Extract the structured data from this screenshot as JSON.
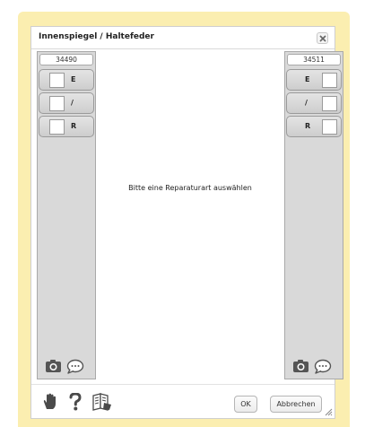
{
  "dialog": {
    "title": "Innenspiegel / Haltefeder"
  },
  "left_panel": {
    "code": "34490",
    "buttons": [
      {
        "label": "E"
      },
      {
        "label": "/"
      },
      {
        "label": "R"
      }
    ]
  },
  "right_panel": {
    "code": "34511",
    "buttons": [
      {
        "label": "E"
      },
      {
        "label": "/"
      },
      {
        "label": "R"
      }
    ]
  },
  "main": {
    "message": "Bitte eine Reparaturart auswählen"
  },
  "footer": {
    "ok_label": "OK",
    "cancel_label": "Abbrechen"
  },
  "icons": {
    "close": "close-icon",
    "camera": "camera-icon",
    "comment": "comment-icon",
    "hand": "hand-icon",
    "help": "help-icon",
    "book": "book-icon"
  }
}
